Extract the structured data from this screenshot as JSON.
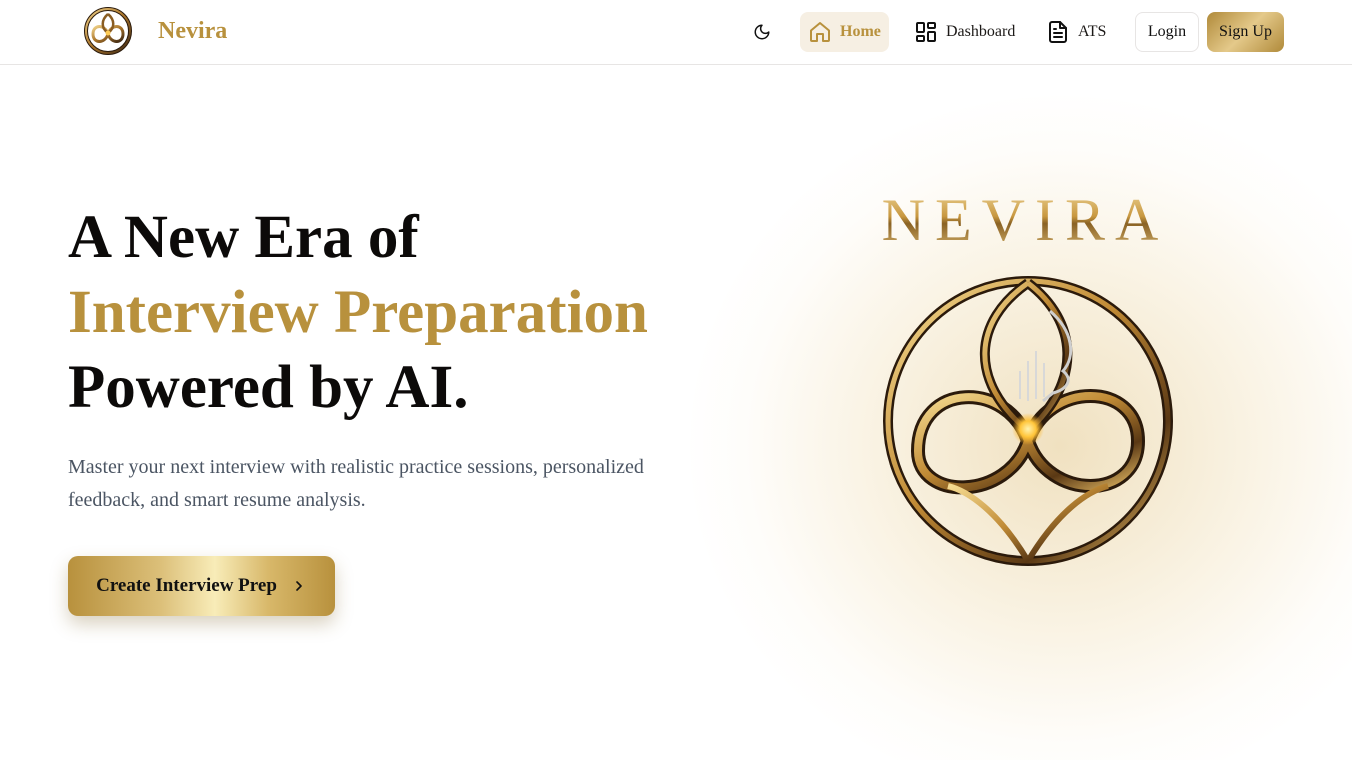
{
  "brand": {
    "name": "Nevira",
    "logo_icon": "infinity-emblem-icon"
  },
  "nav": {
    "theme_icon": "moon-icon",
    "items": [
      {
        "label": "Home",
        "icon": "home-icon",
        "active": true
      },
      {
        "label": "Dashboard",
        "icon": "grid-icon",
        "active": false
      },
      {
        "label": "ATS",
        "icon": "document-icon",
        "active": false
      }
    ],
    "login_label": "Login",
    "signup_label": "Sign Up"
  },
  "hero": {
    "title_line1": "A New Era of",
    "title_line2": "Interview Preparation",
    "title_line3": "Powered by AI.",
    "subtitle": "Master your next interview with realistic practice sessions, personalized feedback, and smart resume analysis.",
    "cta_label": "Create Interview Prep",
    "cta_icon": "chevron-right-icon",
    "art_word": "NEVIRA",
    "art_icon": "infinity-emblem-icon"
  },
  "colors": {
    "gold": "#b8913d",
    "active_bg": "#f6efe3",
    "text_dark": "#0c0a09",
    "text_muted": "#4b5563"
  }
}
